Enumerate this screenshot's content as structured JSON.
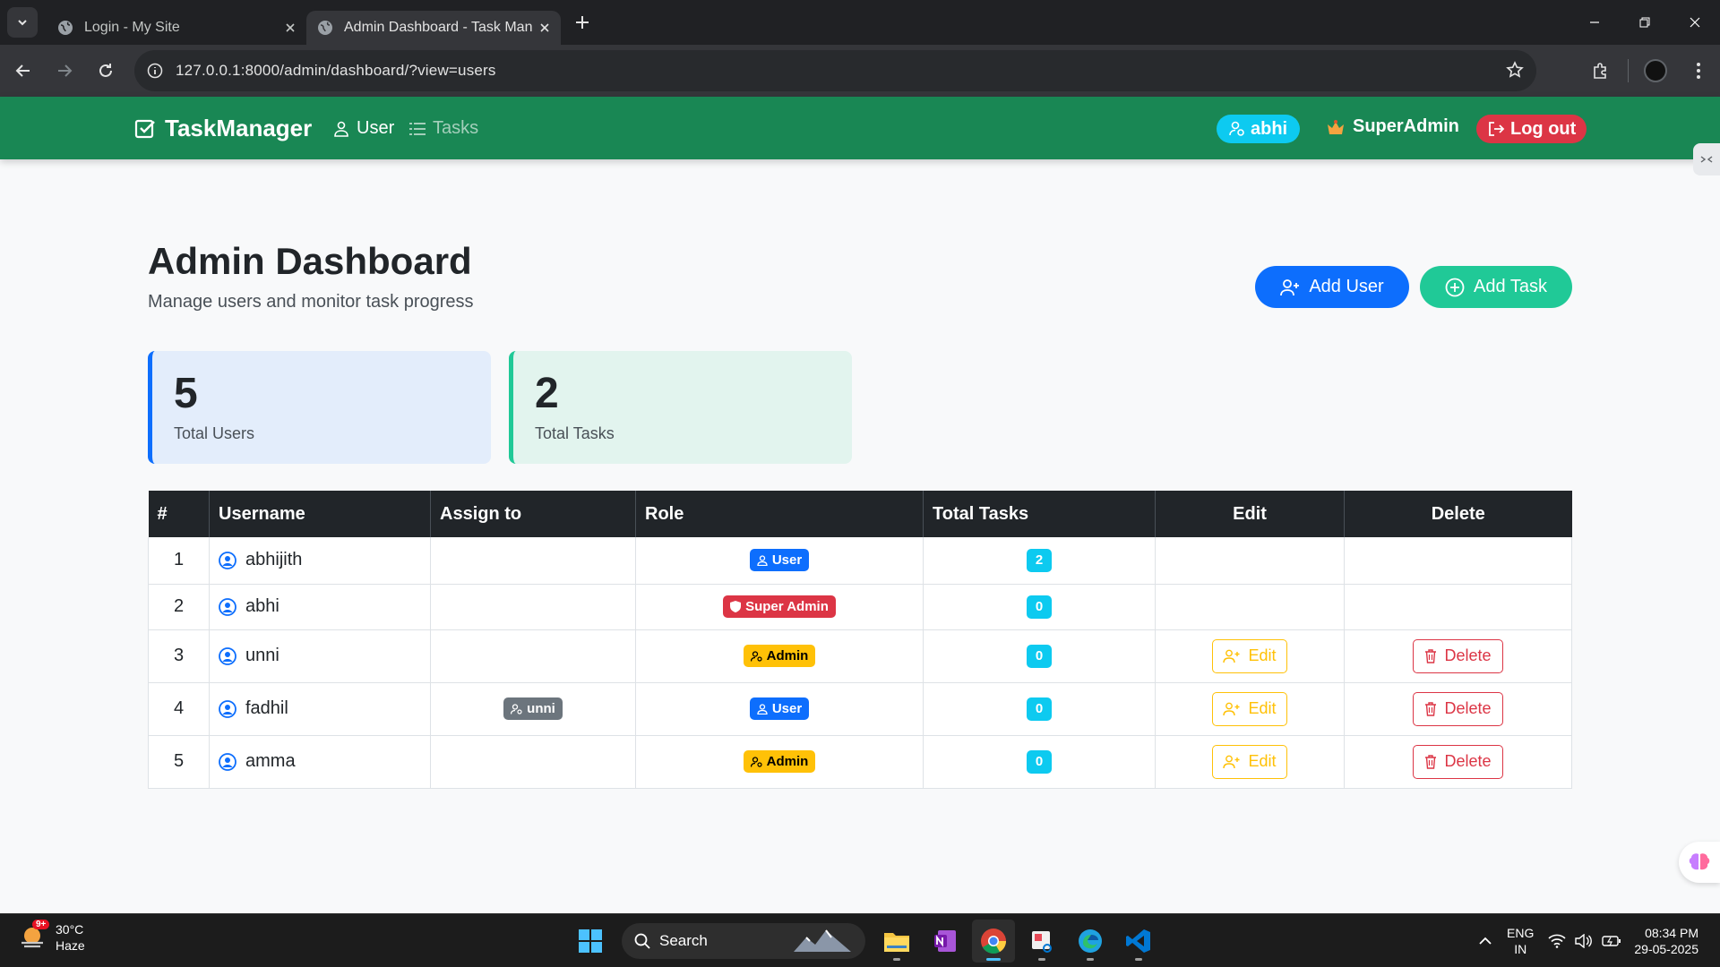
{
  "browser": {
    "tabs": [
      {
        "title": "Login - My Site",
        "active": false
      },
      {
        "title": "Admin Dashboard - Task Manag",
        "active": true
      }
    ],
    "url": "127.0.0.1:8000/admin/dashboard/?view=users"
  },
  "navbar": {
    "brand": "TaskManager",
    "links": [
      "User",
      "Tasks"
    ],
    "current_user": "abhi",
    "role": "SuperAdmin",
    "logout": "Log out",
    "color": "#198754"
  },
  "page": {
    "title": "Admin Dashboard",
    "subtitle": "Manage users and monitor task progress",
    "add_user": "Add User",
    "add_task": "Add Task"
  },
  "stats": [
    {
      "value": "5",
      "label": "Total Users"
    },
    {
      "value": "2",
      "label": "Total Tasks"
    }
  ],
  "table": {
    "headers": [
      "#",
      "Username",
      "Assign to",
      "Role",
      "Total Tasks",
      "Edit",
      "Delete"
    ],
    "rows": [
      {
        "n": "1",
        "username": "abhijith",
        "assign": "",
        "role": "User",
        "tasks": "2",
        "edit": "",
        "delete": ""
      },
      {
        "n": "2",
        "username": "abhi",
        "assign": "",
        "role": "Super Admin",
        "tasks": "0",
        "edit": "",
        "delete": ""
      },
      {
        "n": "3",
        "username": "unni",
        "assign": "",
        "role": "Admin",
        "tasks": "0",
        "edit": "Edit",
        "delete": "Delete"
      },
      {
        "n": "4",
        "username": "fadhil",
        "assign": "unni",
        "role": "User",
        "tasks": "0",
        "edit": "Edit",
        "delete": "Delete"
      },
      {
        "n": "5",
        "username": "amma",
        "assign": "",
        "role": "Admin",
        "tasks": "0",
        "edit": "Edit",
        "delete": "Delete"
      }
    ]
  },
  "taskbar": {
    "weather_temp": "30°C",
    "weather_desc": "Haze",
    "weather_badge": "9+",
    "search": "Search",
    "lang1": "ENG",
    "lang2": "IN",
    "time": "08:34 PM",
    "date": "29-05-2025"
  }
}
